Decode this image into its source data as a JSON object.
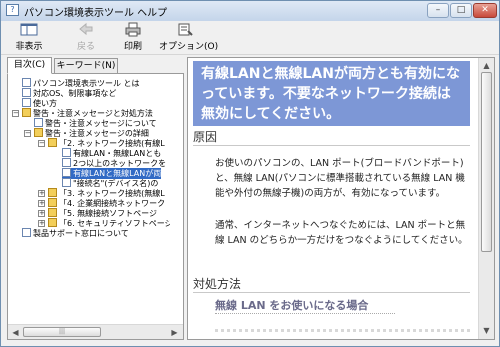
{
  "window": {
    "title": "パソコン環境表示ツール ヘルプ",
    "controls": {
      "minimize": "–",
      "maximize": "□",
      "close": "✕"
    }
  },
  "toolbar": {
    "hide_label": "非表示",
    "back_label": "戻る",
    "print_label": "印刷",
    "options_label": "オプション(O)"
  },
  "navpane": {
    "tabs": [
      {
        "label": "目次(C)",
        "active": true
      },
      {
        "label": "キーワード(N)",
        "active": false
      }
    ],
    "tree": [
      {
        "text": "パソコン環境表示ツール とは",
        "icon": "doc-icon"
      },
      {
        "text": "対応OS、制限事項など",
        "icon": "doc-icon"
      },
      {
        "text": "使い方",
        "icon": "doc-icon"
      },
      {
        "text": "警告・注意メッセージと対処方法",
        "icon": "folder-icon",
        "expanded": true
      },
      {
        "text": "警告・注意メッセージについて",
        "icon": "doc-icon"
      },
      {
        "text": "警告・注意メッセージの詳細",
        "icon": "folder-icon",
        "expanded": true
      },
      {
        "text": "「2. ネットワーク接続(有線L",
        "icon": "folder-icon",
        "expanded": true
      },
      {
        "text": "有線LAN・無線LANとも",
        "icon": "doc-icon"
      },
      {
        "text": "2つ以上のネットワークを",
        "icon": "doc-icon"
      },
      {
        "text": "有線LANと無線LANが両",
        "icon": "doc-icon",
        "selected": true
      },
      {
        "text": "\"接続名\"(デバイス名)の",
        "icon": "doc-icon"
      },
      {
        "text": "「3. ネットワーク接続(無線L",
        "icon": "folder-icon",
        "expanded": false
      },
      {
        "text": "「4. 企業網接続ネットワーク",
        "icon": "folder-icon",
        "expanded": false
      },
      {
        "text": "「5. 無線接続ソフトページ",
        "icon": "folder-icon",
        "expanded": false
      },
      {
        "text": "「6. セキュリティソフトページ",
        "icon": "folder-icon",
        "expanded": false
      },
      {
        "text": "製品サポート窓口について",
        "icon": "doc-icon"
      }
    ]
  },
  "content": {
    "banner_title": "有線LANと無線LANが両方とも有効になっています。不要なネットワーク接続は無効にしてください。",
    "section_cause": "原因",
    "cause_para1": "お使いのパソコンの、LAN ポート(ブロードバンドポート)と、無線 LAN(パソコンに標準搭載されている無線 LAN 機能や外付の無線子機)の両方が、有効になっています。",
    "cause_para2": "通常、インターネットへつなぐためには、LAN ポートと無線 LAN のどちらか一方だけをつなぐようにしてください。",
    "section_fix": "対処方法",
    "fix_subhead": "無線 LAN をお使いになる場合"
  },
  "icons": {
    "app": "app-icon",
    "hide": "hide-pane-icon",
    "back": "back-arrow-icon",
    "print": "printer-icon",
    "options": "options-icon"
  },
  "colors": {
    "banner_bg": "#7d97d6",
    "selection": "#316ac5"
  }
}
